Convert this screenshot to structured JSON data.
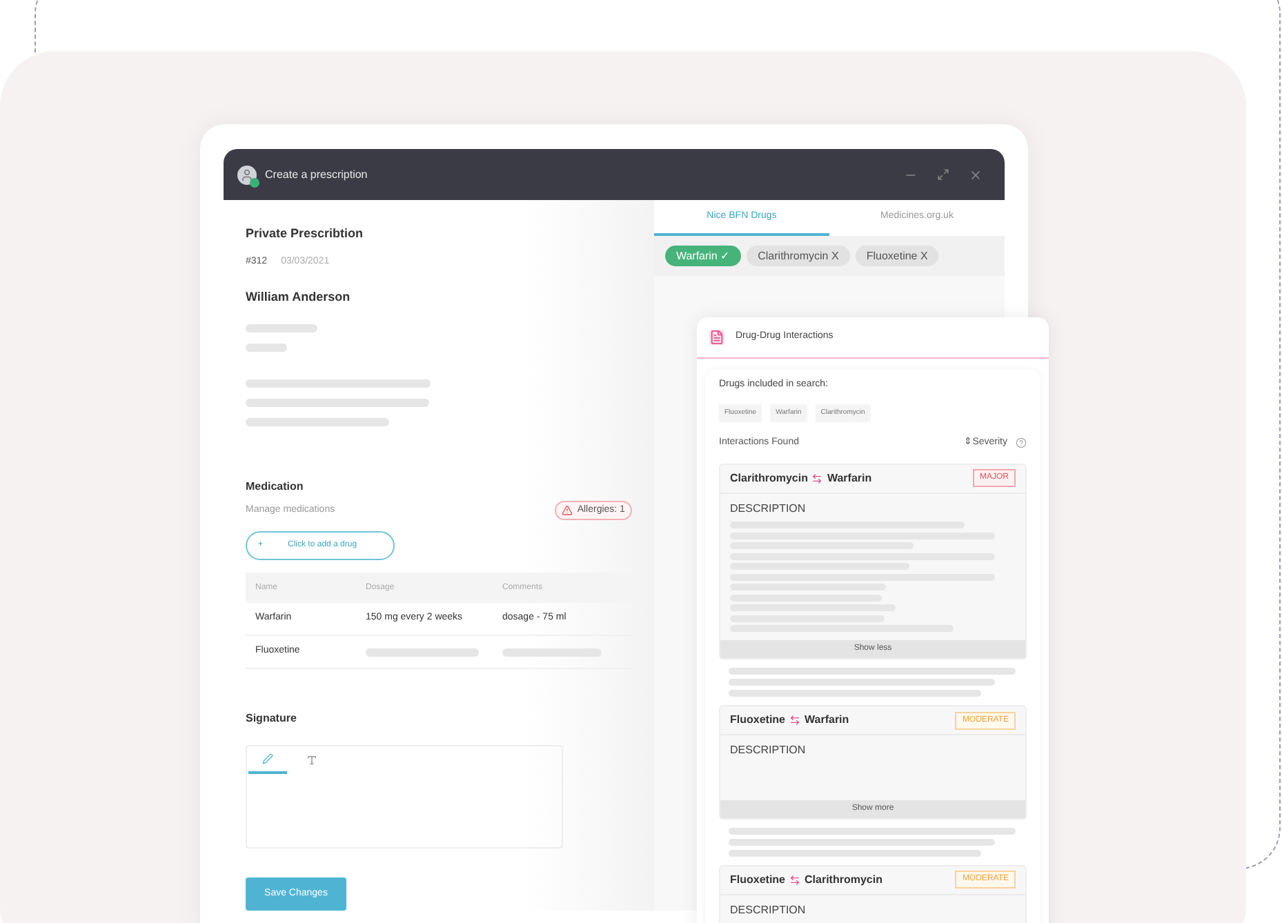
{
  "window": {
    "title": "Create a prescription"
  },
  "prescription": {
    "title": "Private Prescribtion",
    "number": "#312",
    "date": "03/03/2021",
    "patient": "William Anderson"
  },
  "medication": {
    "title": "Medication",
    "subtitle": "Manage medications",
    "allergies": "Allergies: 1",
    "add_button": "Click to add a drug",
    "add_symbol": "+",
    "columns": [
      "Name",
      "Dosage",
      "Comments"
    ],
    "rows": [
      {
        "name": "Warfarin",
        "dosage": "150 mg every 2 weeks",
        "comments": "dosage - 75 ml"
      },
      {
        "name": "Fluoxetine"
      }
    ]
  },
  "signature": {
    "title": "Signature",
    "modes": [
      {
        "kind": "draw",
        "selected": true
      },
      {
        "kind": "type",
        "selected": false
      }
    ]
  },
  "save_button": "Save Changes",
  "drug_tabs": [
    {
      "label": "Nice BFN Drugs",
      "selected": true
    },
    {
      "label": "Medicines.org.uk",
      "selected": false
    }
  ],
  "drug_chips": [
    {
      "label": "Warfarin",
      "mark": "✓",
      "selected": true
    },
    {
      "label": "Clarithromycin",
      "mark": "X",
      "selected": false
    },
    {
      "label": "Fluoxetine",
      "mark": "X",
      "selected": false
    }
  ],
  "interactions_panel": {
    "title": "Drug-Drug Interactions",
    "search_label": "Drugs included in search:",
    "search_drugs": [
      "Fluoxetine",
      "Warfarin",
      "Clarithromycin"
    ],
    "found_label": "Interactions Found",
    "sort_label": "⇕Severity",
    "interactions": [
      {
        "drug_a": "Clarithromycin",
        "drug_b": "Warfarin",
        "severity": "MAJOR",
        "kind": "major",
        "heading": "DESCRIPTION",
        "toggle": "Show less",
        "expanded": true
      },
      {
        "drug_a": "Fluoxetine",
        "drug_b": "Warfarin",
        "severity": "MODERATE",
        "kind": "moderate",
        "heading": "DESCRIPTION",
        "toggle": "Show more",
        "expanded": false
      },
      {
        "drug_a": "Fluoxetine",
        "drug_b": "Clarithromycin",
        "severity": "MODERATE",
        "kind": "moderate",
        "heading": "DESCRIPTION"
      }
    ]
  }
}
